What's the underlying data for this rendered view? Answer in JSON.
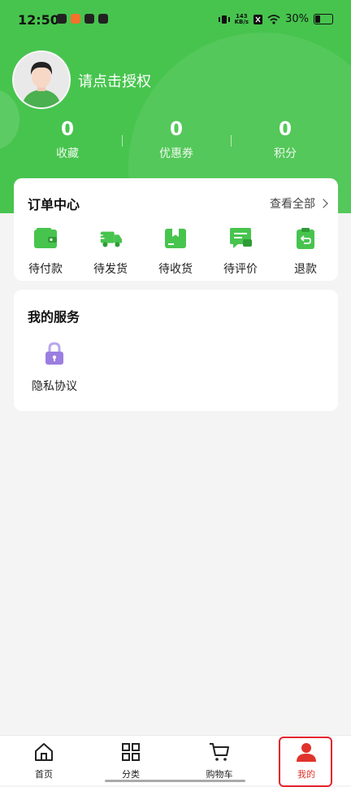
{
  "status_bar": {
    "time": "12:50",
    "speed_value": "143",
    "speed_unit": "KB/s",
    "battery": "30%"
  },
  "profile": {
    "login_prompt": "请点击授权"
  },
  "stats": [
    {
      "value": "0",
      "label": "收藏"
    },
    {
      "value": "0",
      "label": "优惠券"
    },
    {
      "value": "0",
      "label": "积分"
    }
  ],
  "orders": {
    "title": "订单中心",
    "view_all": "查看全部",
    "items": [
      {
        "label": "待付款",
        "icon": "wallet-icon"
      },
      {
        "label": "待发货",
        "icon": "truck-icon"
      },
      {
        "label": "待收货",
        "icon": "box-icon"
      },
      {
        "label": "待评价",
        "icon": "comment-icon"
      },
      {
        "label": "退款",
        "icon": "refund-icon"
      }
    ]
  },
  "services": {
    "title": "我的服务",
    "items": [
      {
        "label": "隐私协议",
        "icon": "lock-icon"
      }
    ]
  },
  "tabbar": {
    "items": [
      {
        "label": "首页",
        "icon": "home-icon"
      },
      {
        "label": "分类",
        "icon": "grid-icon"
      },
      {
        "label": "购物车",
        "icon": "cart-icon"
      },
      {
        "label": "我的",
        "icon": "user-icon",
        "active": true
      }
    ]
  },
  "colors": {
    "brand_green": "#47c44e",
    "active_red": "#e0332c",
    "lock_purple": "#9b7ee0"
  }
}
